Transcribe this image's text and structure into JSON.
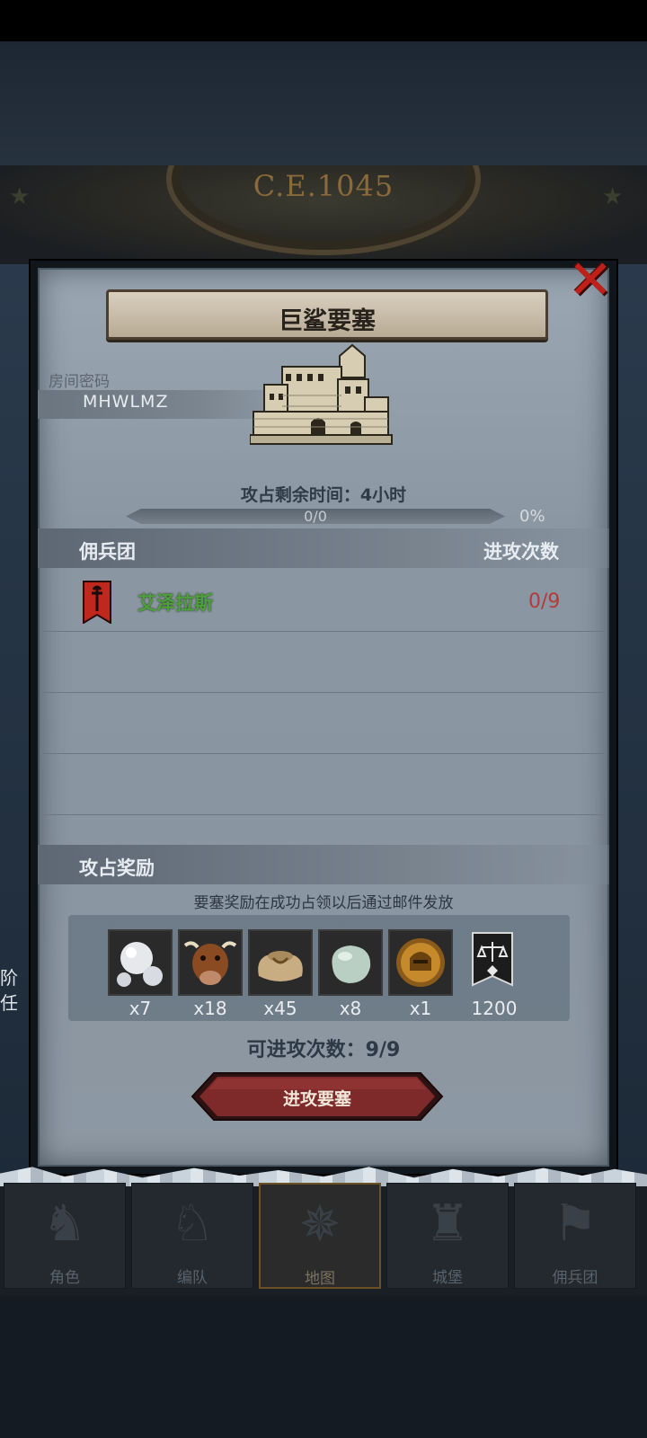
{
  "header": {
    "year": "C.E.1045"
  },
  "modal": {
    "title": "巨鲨要塞",
    "room_password_label": "房间密码",
    "room_password": "MHWLMZ",
    "capture_time_text": "攻占剩余时间：4小时",
    "progress": {
      "count_text": "0/0",
      "percent_text": "0%",
      "fraction": 0
    },
    "mercenary_section": {
      "title": "佣兵团",
      "attacks_header": "进攻次数"
    },
    "mercenaries": [
      {
        "name": "艾泽拉斯",
        "attacks": "0/9",
        "name_color": "#4da03a",
        "attacks_color": "#b53a3a"
      }
    ],
    "reward_section": {
      "title": "攻占奖励",
      "note": "要塞奖励在成功占领以后通过邮件发放",
      "items": [
        {
          "icon": "pearl-icon",
          "count": "x7"
        },
        {
          "icon": "ox-icon",
          "count": "x18"
        },
        {
          "icon": "grain-sack-icon",
          "count": "x45"
        },
        {
          "icon": "jade-stone-icon",
          "count": "x8"
        },
        {
          "icon": "knight-medal-icon",
          "count": "x1"
        },
        {
          "icon": "justice-flag-icon",
          "count": "1200"
        }
      ]
    },
    "attempts_text": "可进攻次数：9/9",
    "attack_button": "进攻要塞"
  },
  "bottom_nav": [
    {
      "label": "角色",
      "icon": "knight-helmet-icon",
      "active": false
    },
    {
      "label": "编队",
      "icon": "cavalry-icon",
      "active": false
    },
    {
      "label": "地图",
      "icon": "compass-icon",
      "active": true
    },
    {
      "label": "城堡",
      "icon": "castle-icon",
      "active": false
    },
    {
      "label": "佣兵团",
      "icon": "mercenary-icon",
      "active": false
    }
  ],
  "left_peek": {
    "line1": "阶",
    "line2": "任"
  },
  "colors": {
    "accent_red": "#c0201a",
    "button_red": "#7e2a2a",
    "merc_green": "#4da03a"
  }
}
